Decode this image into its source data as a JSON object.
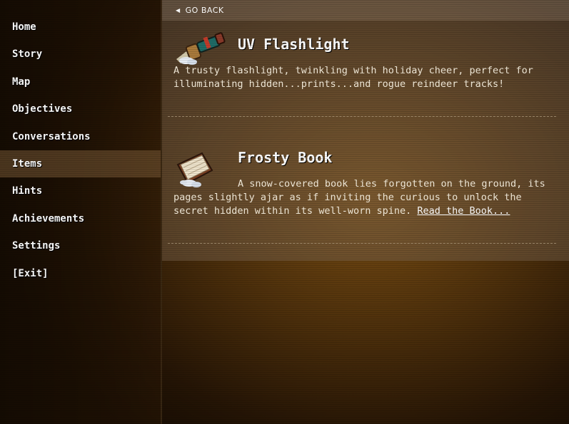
{
  "sidebar": {
    "items": [
      {
        "label": "Home",
        "active": false
      },
      {
        "label": "Story",
        "active": false
      },
      {
        "label": "Map",
        "active": false
      },
      {
        "label": "Objectives",
        "active": false
      },
      {
        "label": "Conversations",
        "active": false
      },
      {
        "label": "Items",
        "active": true
      },
      {
        "label": "Hints",
        "active": false
      },
      {
        "label": "Achievements",
        "active": false
      },
      {
        "label": "Settings",
        "active": false
      },
      {
        "label": "[Exit]",
        "active": false
      }
    ]
  },
  "main": {
    "go_back_label": "GO BACK",
    "items": [
      {
        "title": "UV Flashlight",
        "icon": "flashlight-icon",
        "description": "A trusty flashlight, twinkling with holiday cheer, perfect for illuminating hidden...prints...and rogue reindeer tracks!"
      },
      {
        "title": "Frosty Book",
        "icon": "book-icon",
        "description": "A snow-covered book lies forgotten on the ground, its pages slightly ajar as if inviting the curious to unlock the secret hidden within its well-worn spine.",
        "link_label": "Read the Book..."
      }
    ]
  },
  "colors": {
    "background_glow": "#7a4e13",
    "active_nav": "#78593a",
    "text": "#f5eddc"
  }
}
